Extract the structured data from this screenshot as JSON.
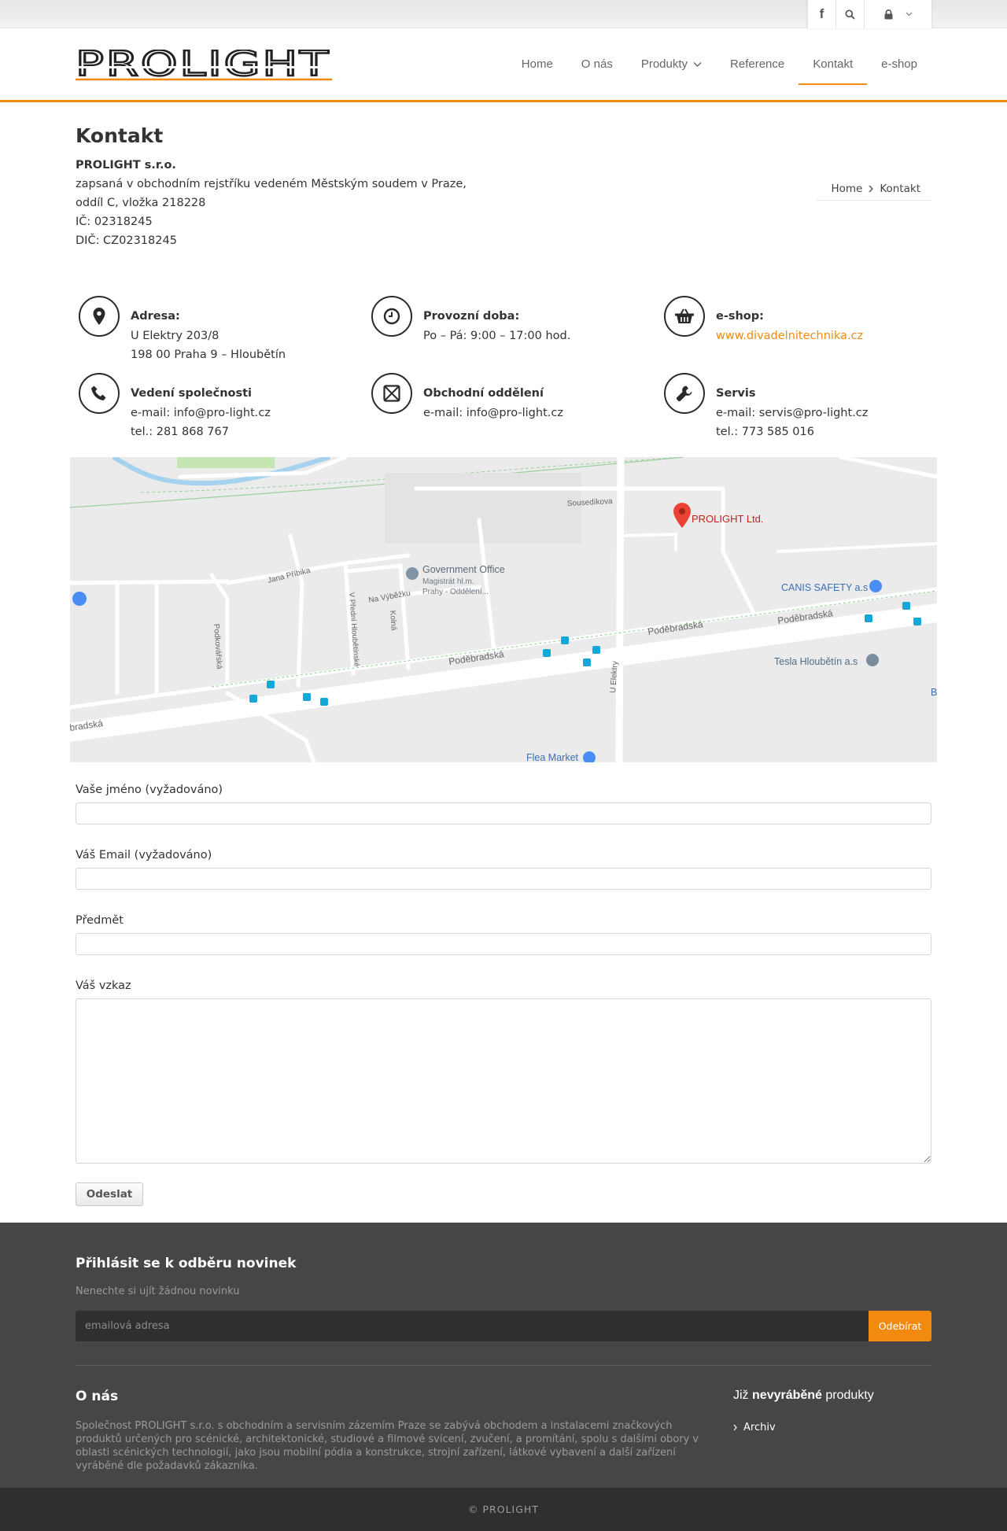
{
  "topbar": {
    "facebook_icon": "facebook-icon",
    "search_icon": "search-icon",
    "lock_icon": "lock-icon"
  },
  "header": {
    "logo_text": "PROLIGHT",
    "brand_color": "#f18a0f",
    "nav": [
      {
        "label": "Home"
      },
      {
        "label": "O nás"
      },
      {
        "label": "Produkty"
      },
      {
        "label": "Reference"
      },
      {
        "label": "Kontakt",
        "active": true
      },
      {
        "label": "e-shop"
      }
    ]
  },
  "page": {
    "title": "Kontakt",
    "company_name": "PROLIGHT s.r.o.",
    "company_lines": [
      "zapsaná v obchodním rejstříku vedeném Městským soudem v Praze,",
      "oddíl C, vložka 218228",
      "IČ: 02318245",
      "DIČ: CZ02318245"
    ],
    "breadcrumb": {
      "home": "Home",
      "current": "Kontakt"
    }
  },
  "info": {
    "address": {
      "title": "Adresa:",
      "line1": "U Elektry 203/8",
      "line2": "198 00 Praha 9 – Hloubětín"
    },
    "hours": {
      "title": "Provozní doba:",
      "line1": "Po – Pá: 9:00 – 17:00 hod."
    },
    "eshop": {
      "title": "e-shop:",
      "link": "www.divadelnitechnika.cz"
    },
    "management": {
      "title": "Vedení společnosti",
      "line1": "e-mail: info@pro-light.cz",
      "line2": "tel.: 281 868 767"
    },
    "sales": {
      "title": "Obchodní oddělení",
      "line1": "e-mail: info@pro-light.cz"
    },
    "service": {
      "title": "Servis",
      "line1": "e-mail: servis@pro-light.cz",
      "line2": "tel.: 773 585 016"
    }
  },
  "map": {
    "marker_label": "PROLIGHT Ltd.",
    "streets": {
      "sousedikova": "Sousedíkova",
      "jana_pribika": "Jana Příbika",
      "na_vybezku": "Na Výběžku",
      "v_predni": "V Přední Hloubětínské",
      "kolna": "Kolná",
      "podkovarska": "Podkovářská",
      "podebradska": "Poděbradská",
      "podebradska_partial": "bradská",
      "u_elektry": "U Elektry"
    },
    "places": {
      "gov_title": "Government Office",
      "gov_line1": "Magistrát hl.m.",
      "gov_line2": "Prahy - Oddělení...",
      "canis": "CANIS SAFETY a.s",
      "tesla": "Tesla Hloubětín a.s",
      "flea": "Flea Market",
      "edge_b": "B"
    }
  },
  "form": {
    "name_label": "Vaše jméno (vyžadováno)",
    "email_label": "Váš Email (vyžadováno)",
    "subject_label": "Předmět",
    "message_label": "Váš vzkaz",
    "submit_label": "Odeslat"
  },
  "footer": {
    "newsletter_title": "Přihlásit se k odběru novinek",
    "newsletter_sub": "Nenechte si ujít žádnou novinku",
    "email_placeholder": "emailová adresa",
    "subscribe_label": "Odebírat",
    "about_title": "O nás",
    "about_text": "Společnost PROLIGHT s.r.o. s obchodním a servisním zázemím Praze se zabývá obchodem a instalacemi značkových produktů určených pro scénické, architektonické, studiové a filmové svícení, zvučení, a promítání, spolu s dalšími obory v oblasti scénických technologií, jako jsou mobilní pódia a konstrukce, strojní zařízení, látkové vybavení a další zařízení vyráběné dle požadavků zákazníka.",
    "discontinued_prefix": "Již",
    "discontinued_bold": "nevyráběné",
    "discontinued_suffix": "produkty",
    "archive_link": "Archiv",
    "copyright": "© PROLIGHT"
  }
}
